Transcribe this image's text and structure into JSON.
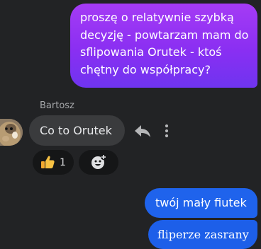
{
  "messages": {
    "outgoing_1": "proszę o relatywnie szybką decyzję - powtarzam mam do sflipowania Orutek - ktoś chętny do współpracy?",
    "incoming_sender": "Bartosz",
    "incoming_text": "Co to Orutek",
    "reaction_count": "1",
    "outgoing_2": "twój mały fiutek",
    "outgoing_3": "fliperze zasrany"
  },
  "icons": {
    "reply": "reply-icon",
    "more": "more-options-icon",
    "reaction": "thumbs-up-icon",
    "add_reaction": "add-reaction-icon"
  },
  "colors": {
    "background": "#222325",
    "outgoing_gradient_top": "#a53bf5",
    "outgoing_gradient_bottom": "#6f34f0",
    "incoming_bubble": "#3a3b3d",
    "outgoing_blue": "#1f63ec",
    "muted_text": "#a6a8ab"
  }
}
